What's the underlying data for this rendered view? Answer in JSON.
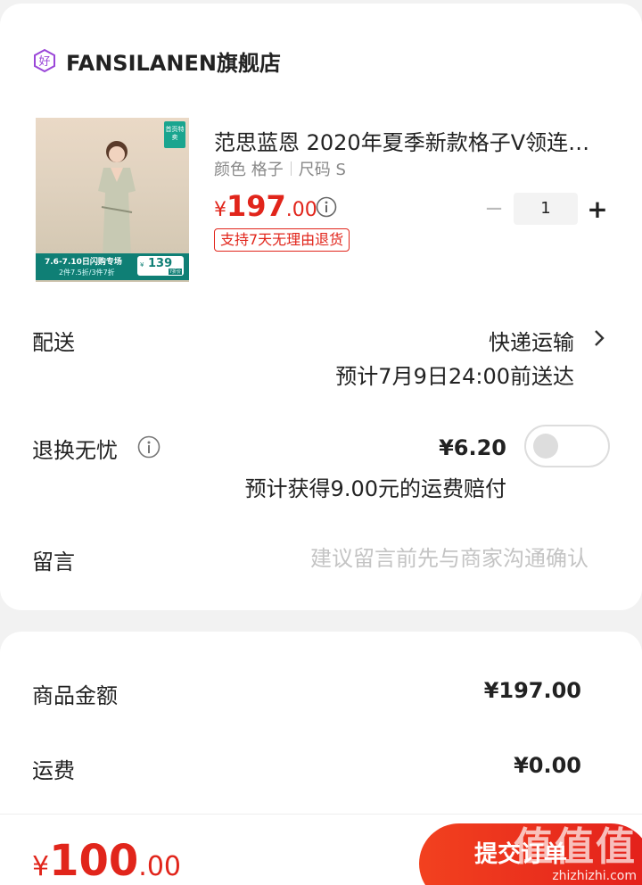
{
  "shop": {
    "name": "FANSILANEN旗舰店",
    "icon": "shop-badge-icon",
    "icon_glyph": "好",
    "icon_color": "#9a46d8"
  },
  "product": {
    "title": "范思蓝恩 2020年夏季新款格子V领连…",
    "spec_color": "颜色 格子",
    "spec_size": "尺码 S",
    "price_symbol": "¥",
    "price_int": "197",
    "price_dec": ".00",
    "return_tag": "支持7天无理由退货",
    "quantity": "1",
    "minus": "−",
    "plus": "+",
    "image": {
      "corner_badge": "首页特卖",
      "promo_line1": "7.6-7.10日闪购专场",
      "promo_line2": "2件7.5折/3件7折",
      "promo_price_symbol": "¥",
      "promo_price": "139",
      "promo_note": "7折价"
    }
  },
  "delivery": {
    "label": "配送",
    "method": "快递运输",
    "eta": "预计7月9日24:00前送达"
  },
  "return_insurance": {
    "label": "退换无忧",
    "price": "¥6.20",
    "compensation": "预计获得9.00元的运费赔付",
    "enabled": false
  },
  "message": {
    "label": "留言",
    "placeholder": "建议留言前先与商家沟通确认"
  },
  "summary": {
    "goods_label": "商品金额",
    "goods_value": "¥197.00",
    "shipping_label": "运费",
    "shipping_value": "¥0.00"
  },
  "footer": {
    "total_symbol": "¥",
    "total_int": "100",
    "total_dec": ".00",
    "submit_label": "提交订单"
  },
  "watermark": {
    "logo": "值值值",
    "text": "zhizhizhi.com"
  },
  "colors": {
    "accent": "#e1251b",
    "text": "#222222",
    "muted": "#888888",
    "placeholder": "#c4c4c4"
  }
}
